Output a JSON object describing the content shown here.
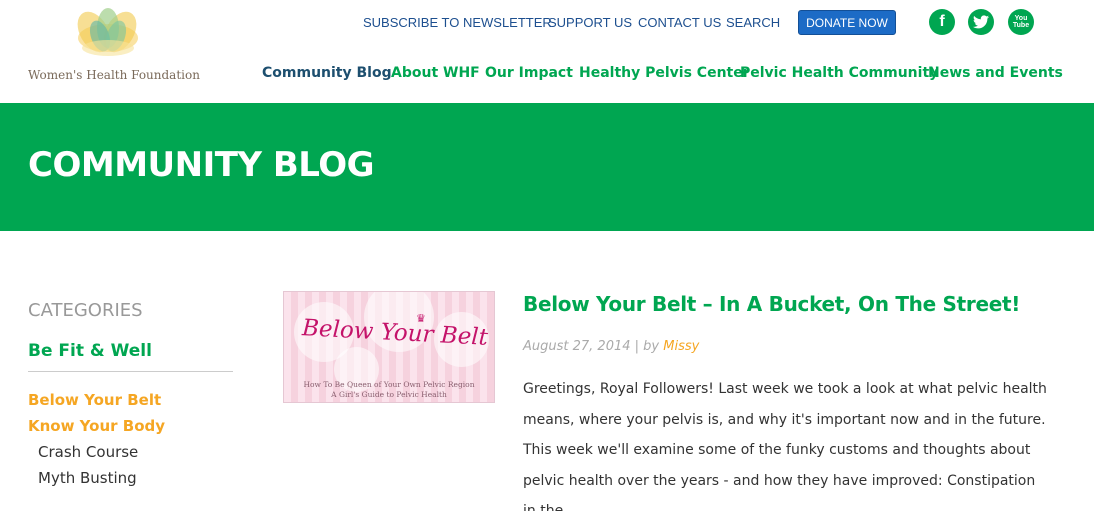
{
  "brand": {
    "name": "Women's Health Foundation"
  },
  "top_nav": {
    "subscribe": "SUBSCRIBE TO NEWSLETTER",
    "support": "SUPPORT US",
    "contact": "CONTACT US",
    "search": "SEARCH",
    "donate": "DONATE NOW"
  },
  "social": {
    "facebook": "f",
    "youtube_line1": "You",
    "youtube_line2": "Tube"
  },
  "main_nav": {
    "items": [
      {
        "label": "Community Blog"
      },
      {
        "label": "About WHF"
      },
      {
        "label": "Our Impact"
      },
      {
        "label": "Healthy Pelvis Center"
      },
      {
        "label": "Pelvic Health Community"
      },
      {
        "label": "News and Events"
      }
    ]
  },
  "banner": {
    "title": "COMMUNITY BLOG"
  },
  "sidebar": {
    "heading": "CATEGORIES",
    "main_category": "Be Fit & Well",
    "items": [
      {
        "label": "Below Your Belt"
      },
      {
        "label": "Know Your Body"
      },
      {
        "label": "Crash Course"
      },
      {
        "label": "Myth Busting"
      }
    ]
  },
  "thumbnail": {
    "title": "Below Your Belt",
    "subtitle1": "How To Be Queen of Your Own Pelvic Region",
    "subtitle2": "A Girl's Guide to Pelvic Health"
  },
  "post": {
    "title": "Below Your Belt – In A Bucket, On The Street!",
    "date": "August 27, 2014",
    "separator": "| by",
    "author": "Missy",
    "excerpt": "Greetings, Royal Followers! Last week we took a look at what pelvic health means, where your pelvis is, and why it's important now and in the future. This week we'll examine some of the funky customs and thoughts about pelvic health over the years -  and how they have improved: Constipation in the"
  },
  "colors": {
    "green": "#00a651",
    "blue": "#1d4f8f",
    "orange": "#f5a623",
    "donate_blue": "#1c6bc6"
  }
}
